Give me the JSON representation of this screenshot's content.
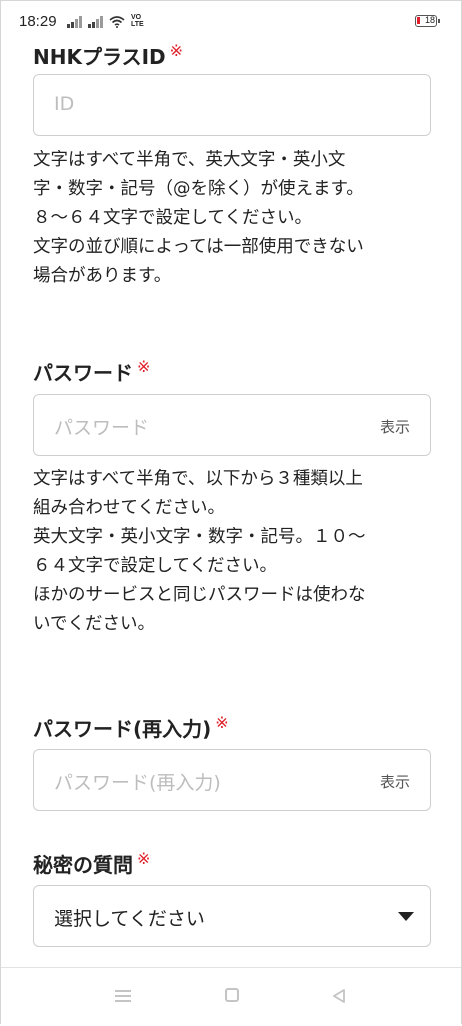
{
  "status_bar": {
    "time": "18:29",
    "volte_top": "VO",
    "volte_bottom": "LTE",
    "battery": "18",
    "battery_color": "#e0202a"
  },
  "form": {
    "required_mark": "※",
    "id_section": {
      "label": "NHKプラスID",
      "placeholder": "ID",
      "help": "文字はすべて半角で、英大文字・英小文\n字・数字・記号（@を除く）が使えます。\n８～６４文字で設定してください。\n文字の並び順によっては一部使用できない\n場合があります。"
    },
    "password_section": {
      "label": "パスワード",
      "placeholder": "パスワード",
      "show_label": "表示",
      "help": "文字はすべて半角で、以下から３種類以上\n組み合わせてください。\n英大文字・英小文字・数字・記号。１０～\n６４文字で設定してください。\nほかのサービスと同じパスワードは使わな\nいでください。"
    },
    "password_confirm_section": {
      "label": "パスワード(再入力)",
      "placeholder": "パスワード(再入力)",
      "show_label": "表示"
    },
    "secret_question_section": {
      "label": "秘密の質問",
      "selected": "選択してください"
    }
  },
  "nav_bar": {
    "icons": [
      "menu-icon",
      "home-icon",
      "back-icon"
    ]
  }
}
